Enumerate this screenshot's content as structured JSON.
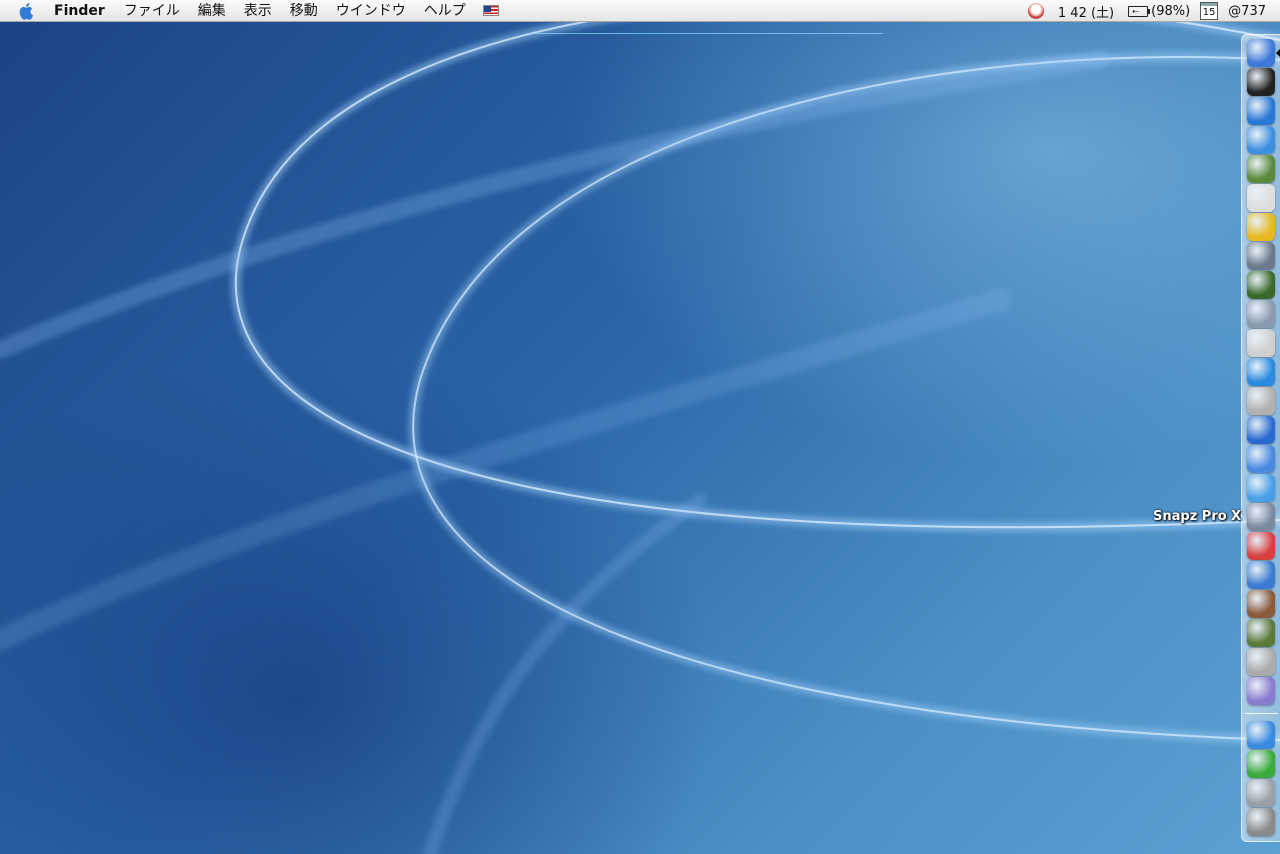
{
  "menubar": {
    "app_name": "Finder",
    "items": [
      "ファイル",
      "編集",
      "表示",
      "移動",
      "ウインドウ",
      "ヘルプ"
    ],
    "input_source": "us-flag-icon",
    "status": {
      "clock": "1 42 (土)",
      "battery": "(98%)",
      "calendar_day": "15",
      "user": "@737"
    }
  },
  "dock": {
    "tooltip": "Snapz Pro X",
    "apps": [
      {
        "name": "finder",
        "color": "#3b78d8"
      },
      {
        "name": "terminal",
        "color": "#222222"
      },
      {
        "name": "internet-explorer",
        "color": "#2a78d6"
      },
      {
        "name": "safari",
        "color": "#3f8fe0"
      },
      {
        "name": "preview",
        "color": "#5a8a3a"
      },
      {
        "name": "mi-editor",
        "color": "#dddddd"
      },
      {
        "name": "sunflower",
        "color": "#e7b820"
      },
      {
        "name": "image-capture",
        "color": "#6a7a8a"
      },
      {
        "name": "fb-app",
        "color": "#3a6a2a"
      },
      {
        "name": "package-builder",
        "color": "#8a9ab0"
      },
      {
        "name": "printer-setup",
        "color": "#cfcfcf"
      },
      {
        "name": "quicktime",
        "color": "#2a8ae0"
      },
      {
        "name": "dvd-player",
        "color": "#b0b0b0"
      },
      {
        "name": "system-info",
        "color": "#2a6ad0"
      },
      {
        "name": "airport",
        "color": "#4a8ae0"
      },
      {
        "name": "ichat",
        "color": "#4aa0e8"
      },
      {
        "name": "snapz-pro-x",
        "color": "#7a8aa0"
      },
      {
        "name": "ical",
        "color": "#d84040"
      },
      {
        "name": "sync",
        "color": "#3a7ad0"
      },
      {
        "name": "tools",
        "color": "#8a5a3a"
      },
      {
        "name": "stuffit",
        "color": "#5a7a3a"
      },
      {
        "name": "apple-hardware",
        "color": "#aaaaaa"
      },
      {
        "name": "itunes",
        "color": "#8a7ad0"
      }
    ],
    "docs": [
      {
        "name": "network-globe",
        "color": "#3a8ae0"
      },
      {
        "name": "music-app",
        "color": "#3aaa3a"
      },
      {
        "name": "applications-folder",
        "color": "#9aa0a8"
      },
      {
        "name": "trash",
        "color": "#8a8a8a"
      }
    ]
  }
}
